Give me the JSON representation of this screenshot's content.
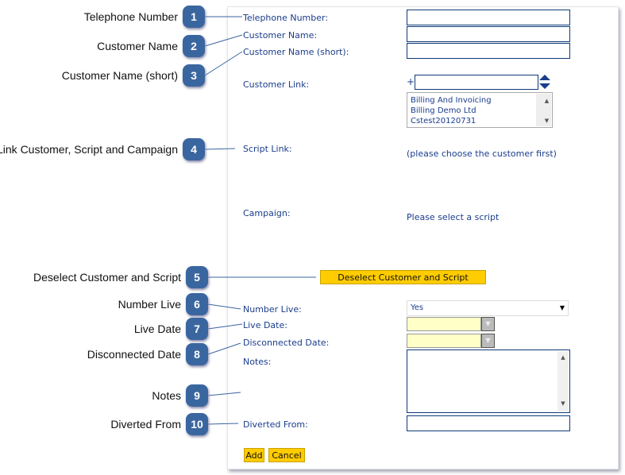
{
  "callouts": [
    {
      "n": "1",
      "label": "Telephone Number"
    },
    {
      "n": "2",
      "label": "Customer Name"
    },
    {
      "n": "3",
      "label": "Customer Name (short)"
    },
    {
      "n": "4",
      "label": "Link Customer, Script and Campaign"
    },
    {
      "n": "5",
      "label": "Deselect Customer and Script"
    },
    {
      "n": "6",
      "label": "Number Live"
    },
    {
      "n": "7",
      "label": "Live Date"
    },
    {
      "n": "8",
      "label": "Disconnected Date"
    },
    {
      "n": "9",
      "label": "Notes"
    },
    {
      "n": "10",
      "label": "Diverted From"
    }
  ],
  "form": {
    "telephone_label": "Telephone Number:",
    "customer_name_label": "Customer Name:",
    "customer_short_label": "Customer Name (short):",
    "customer_link_label": "Customer Link:",
    "plus": "+",
    "customers": [
      "Billing And Invoicing",
      "Billing Demo Ltd",
      "Cstest20120731"
    ],
    "script_link_label": "Script Link:",
    "script_hint": "(please choose the customer first)",
    "campaign_label": "Campaign:",
    "campaign_hint": "Please select a script",
    "deselect_button": "Deselect Customer and Script",
    "number_live_label": "Number Live:",
    "number_live_value": "Yes",
    "live_date_label": "Live Date:",
    "disconnected_date_label": "Disconnected Date:",
    "notes_label": "Notes:",
    "diverted_from_label": "Diverted From:",
    "add_button": "Add",
    "cancel_button": "Cancel"
  },
  "colors": {
    "badge": "#3a66a0",
    "button": "#ffcc00",
    "label": "#1a3d8c"
  }
}
